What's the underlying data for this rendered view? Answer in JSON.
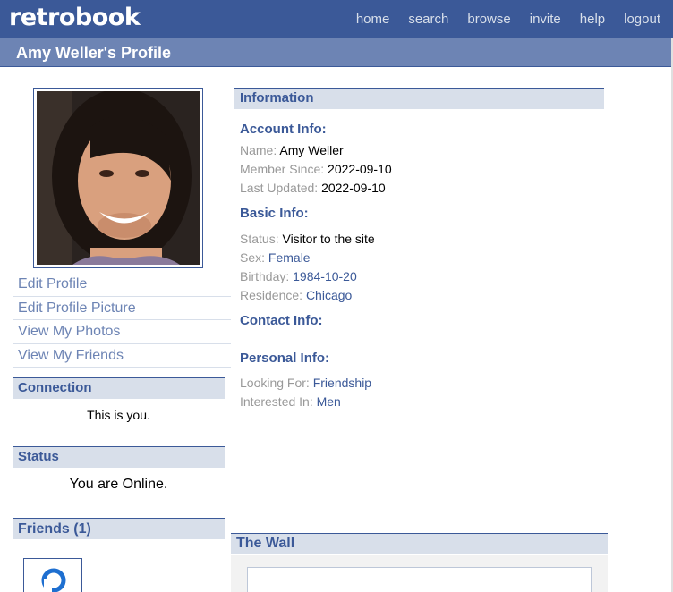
{
  "app": {
    "logo": "retrobook",
    "nav": [
      "home",
      "search",
      "browse",
      "invite",
      "help",
      "logout"
    ]
  },
  "profile_header": {
    "title": "Amy Weller's Profile"
  },
  "sidebar": {
    "actions": [
      "Edit Profile",
      "Edit Profile Picture",
      "View My Photos",
      "View My Friends"
    ],
    "connection": {
      "title": "Connection",
      "text": "This is you."
    },
    "status": {
      "title": "Status",
      "text": "You are Online."
    },
    "friends": {
      "title": "Friends (1)"
    }
  },
  "information": {
    "title": "Information",
    "account": {
      "title": "Account Info:",
      "name_label": "Name:",
      "name": "Amy Weller",
      "member_since_label": "Member Since:",
      "member_since": "2022-09-10",
      "last_updated_label": "Last Updated:",
      "last_updated": "2022-09-10"
    },
    "basic": {
      "title": "Basic Info:",
      "status_label": "Status:",
      "status": "Visitor to the site",
      "sex_label": "Sex:",
      "sex": "Female",
      "birthday_label": "Birthday:",
      "birthday": "1984-10-20",
      "residence_label": "Residence:",
      "residence": "Chicago"
    },
    "contact": {
      "title": "Contact Info:"
    },
    "personal": {
      "title": "Personal Info:",
      "looking_for_label": "Looking For:",
      "looking_for": "Friendship",
      "interested_in_label": "Interested In:",
      "interested_in": "Men"
    }
  },
  "wall": {
    "title": "The Wall"
  },
  "colors": {
    "brand": "#3b5998",
    "header_bar": "#6d84b4",
    "box_head": "#d8dfea"
  }
}
